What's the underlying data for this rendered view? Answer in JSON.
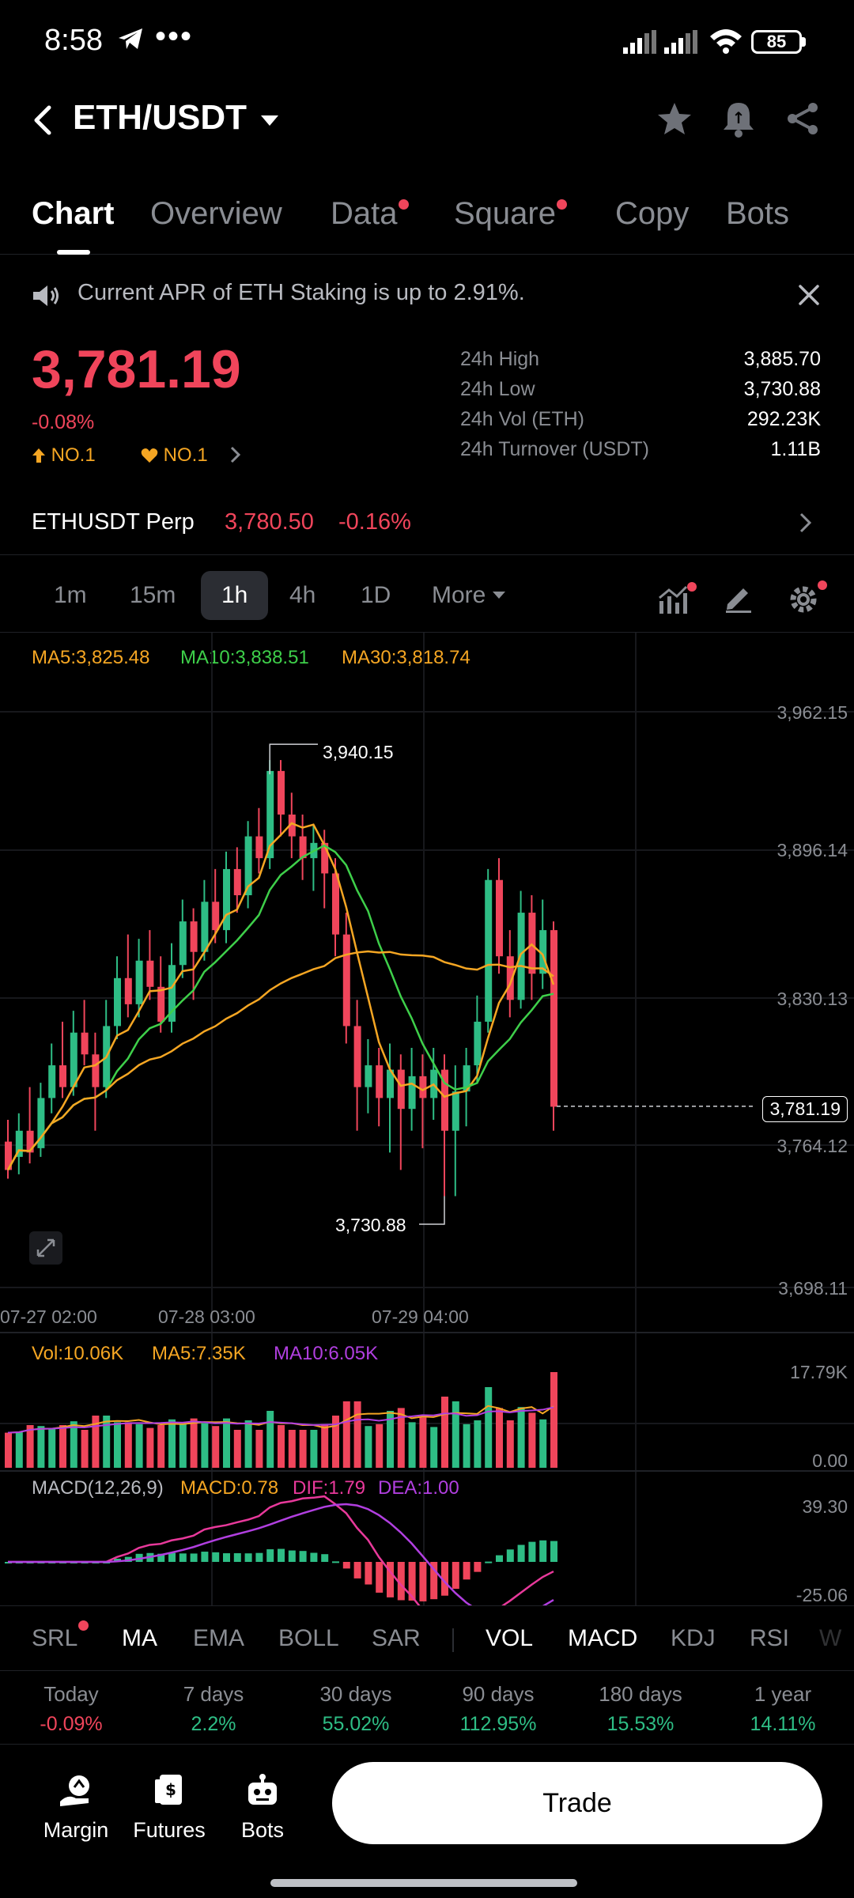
{
  "status_bar": {
    "time": "8:58",
    "dots": "•••",
    "battery": "85"
  },
  "header": {
    "pair": "ETH/USDT"
  },
  "tabs": [
    {
      "label": "Chart",
      "active": true,
      "dot": false
    },
    {
      "label": "Overview",
      "active": false,
      "dot": false
    },
    {
      "label": "Data",
      "active": false,
      "dot": true
    },
    {
      "label": "Square",
      "active": false,
      "dot": true
    },
    {
      "label": "Copy",
      "active": false,
      "dot": false
    },
    {
      "label": "Bots",
      "active": false,
      "dot": false
    }
  ],
  "notice": {
    "text": "Current APR of ETH Staking is up to 2.91%."
  },
  "price": {
    "last": "3,781.19",
    "change": "-0.08%",
    "rank1": "NO.1",
    "rank2": "NO.1"
  },
  "stats": [
    {
      "label": "24h High",
      "value": "3,885.70"
    },
    {
      "label": "24h Low",
      "value": "3,730.88"
    },
    {
      "label": "24h Vol (ETH)",
      "value": "292.23K"
    },
    {
      "label": "24h Turnover (USDT)",
      "value": "1.11B"
    }
  ],
  "perp": {
    "name": "ETHUSDT Perp",
    "price": "3,780.50",
    "change": "-0.16%"
  },
  "timeframes": [
    {
      "label": "1m",
      "active": false
    },
    {
      "label": "15m",
      "active": false
    },
    {
      "label": "1h",
      "active": true
    },
    {
      "label": "4h",
      "active": false
    },
    {
      "label": "1D",
      "active": false
    },
    {
      "label": "More",
      "active": false
    }
  ],
  "ma_legend": {
    "ma5": "MA5:3,825.48",
    "ma10": "MA10:3,838.51",
    "ma30": "MA30:3,818.74"
  },
  "price_axis": [
    "3,962.15",
    "3,896.14",
    "3,830.13",
    "3,764.12",
    "3,698.11"
  ],
  "current_price_tag": "3,781.19",
  "high_marker": "3,940.15",
  "low_marker": "3,730.88",
  "time_axis": [
    "07-27 02:00",
    "07-28 03:00",
    "07-29 04:00"
  ],
  "vol_legend": {
    "vol": "Vol:10.06K",
    "ma5": "MA5:7.35K",
    "ma10": "MA10:6.05K"
  },
  "vol_axis": [
    "17.79K",
    "0.00"
  ],
  "macd_legend": {
    "name": "MACD(12,26,9)",
    "macd": "MACD:0.78",
    "dif": "DIF:1.79",
    "dea": "DEA:1.00"
  },
  "macd_axis": [
    "39.30",
    "-25.06"
  ],
  "indicator_tabs": [
    {
      "label": "SRL",
      "on": false,
      "dot": true
    },
    {
      "label": "MA",
      "on": true,
      "dot": false
    },
    {
      "label": "EMA",
      "on": false,
      "dot": false
    },
    {
      "label": "BOLL",
      "on": false,
      "dot": false
    },
    {
      "label": "SAR",
      "on": false,
      "dot": false
    },
    {
      "label": "VOL",
      "on": true,
      "dot": false
    },
    {
      "label": "MACD",
      "on": true,
      "dot": false
    },
    {
      "label": "KDJ",
      "on": false,
      "dot": false
    },
    {
      "label": "RSI",
      "on": false,
      "dot": false
    },
    {
      "label": "W",
      "on": false,
      "dot": false
    }
  ],
  "performance": [
    {
      "label": "Today",
      "value": "-0.09%",
      "dir": "down"
    },
    {
      "label": "7 days",
      "value": "2.2%",
      "dir": "up"
    },
    {
      "label": "30 days",
      "value": "55.02%",
      "dir": "up"
    },
    {
      "label": "90 days",
      "value": "112.95%",
      "dir": "up"
    },
    {
      "label": "180 days",
      "value": "15.53%",
      "dir": "up"
    },
    {
      "label": "1 year",
      "value": "14.11%",
      "dir": "up"
    }
  ],
  "bottom_nav": [
    {
      "label": "Margin",
      "icon": "margin-icon"
    },
    {
      "label": "Futures",
      "icon": "futures-icon"
    },
    {
      "label": "Bots",
      "icon": "bots-icon"
    }
  ],
  "trade_label": "Trade",
  "colors": {
    "up": "#2ebd85",
    "down": "#f0455b",
    "ma5": "#f5a623",
    "ma10": "#3ecf4a",
    "ma30": "#f5a623",
    "purple": "#b13fe0",
    "pink": "#e8399b"
  },
  "chart_data": {
    "type": "candlestick",
    "ylim": [
      3698.11,
      3962.15
    ],
    "high": 3940.15,
    "low": 3730.88,
    "last": 3781.19,
    "candles_approx": [
      [
        3765,
        3752,
        3775,
        3748
      ],
      [
        3758,
        3770,
        3778,
        3750
      ],
      [
        3770,
        3760,
        3790,
        3755
      ],
      [
        3762,
        3785,
        3792,
        3758
      ],
      [
        3785,
        3800,
        3810,
        3778
      ],
      [
        3800,
        3790,
        3820,
        3785
      ],
      [
        3790,
        3815,
        3825,
        3786
      ],
      [
        3815,
        3805,
        3830,
        3800
      ],
      [
        3805,
        3790,
        3815,
        3770
      ],
      [
        3790,
        3818,
        3830,
        3785
      ],
      [
        3818,
        3840,
        3850,
        3812
      ],
      [
        3840,
        3828,
        3860,
        3822
      ],
      [
        3828,
        3848,
        3858,
        3822
      ],
      [
        3848,
        3836,
        3862,
        3830
      ],
      [
        3836,
        3820,
        3850,
        3815
      ],
      [
        3820,
        3846,
        3856,
        3815
      ],
      [
        3846,
        3866,
        3876,
        3840
      ],
      [
        3866,
        3852,
        3872,
        3830
      ],
      [
        3852,
        3875,
        3885,
        3848
      ],
      [
        3875,
        3862,
        3890,
        3856
      ],
      [
        3862,
        3890,
        3898,
        3856
      ],
      [
        3890,
        3878,
        3900,
        3870
      ],
      [
        3878,
        3905,
        3912,
        3872
      ],
      [
        3905,
        3895,
        3918,
        3888
      ],
      [
        3895,
        3935,
        3940,
        3890
      ],
      [
        3935,
        3915,
        3940,
        3905
      ],
      [
        3915,
        3905,
        3925,
        3895
      ],
      [
        3905,
        3895,
        3915,
        3885
      ],
      [
        3895,
        3902,
        3910,
        3880
      ],
      [
        3902,
        3888,
        3908,
        3872
      ],
      [
        3888,
        3860,
        3895,
        3850
      ],
      [
        3860,
        3818,
        3870,
        3810
      ],
      [
        3818,
        3790,
        3830,
        3770
      ],
      [
        3790,
        3800,
        3812,
        3778
      ],
      [
        3800,
        3785,
        3808,
        3772
      ],
      [
        3785,
        3798,
        3810,
        3760
      ],
      [
        3798,
        3780,
        3805,
        3752
      ],
      [
        3780,
        3795,
        3808,
        3770
      ],
      [
        3795,
        3785,
        3805,
        3762
      ],
      [
        3785,
        3798,
        3808,
        3775
      ],
      [
        3798,
        3770,
        3805,
        3740
      ],
      [
        3770,
        3788,
        3800,
        3740
      ],
      [
        3788,
        3800,
        3808,
        3772
      ],
      [
        3800,
        3820,
        3832,
        3792
      ],
      [
        3820,
        3885,
        3890,
        3815
      ],
      [
        3885,
        3850,
        3895,
        3842
      ],
      [
        3850,
        3830,
        3862,
        3822
      ],
      [
        3830,
        3870,
        3880,
        3826
      ],
      [
        3870,
        3842,
        3878,
        3830
      ],
      [
        3842,
        3862,
        3876,
        3835
      ],
      [
        3862,
        3781,
        3866,
        3770
      ]
    ]
  }
}
